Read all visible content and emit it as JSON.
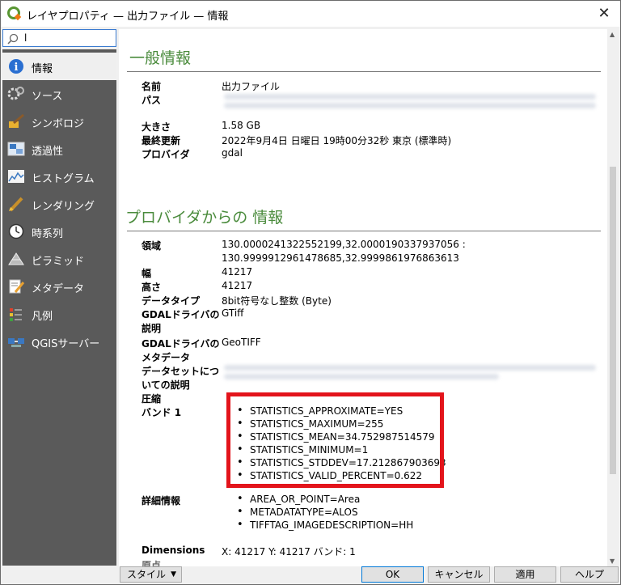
{
  "window": {
    "title": "レイヤプロパティ — 出力ファイル — 情報"
  },
  "search": {
    "value": "l"
  },
  "sidebar": {
    "items": [
      {
        "label": "情報",
        "icon": "info-icon"
      },
      {
        "label": "ソース",
        "icon": "source-icon"
      },
      {
        "label": "シンボロジ",
        "icon": "symbology-icon"
      },
      {
        "label": "透過性",
        "icon": "transparency-icon"
      },
      {
        "label": "ヒストグラム",
        "icon": "histogram-icon"
      },
      {
        "label": "レンダリング",
        "icon": "rendering-icon"
      },
      {
        "label": "時系列",
        "icon": "clock-icon"
      },
      {
        "label": "ピラミッド",
        "icon": "pyramid-icon"
      },
      {
        "label": "メタデータ",
        "icon": "metadata-icon"
      },
      {
        "label": "凡例",
        "icon": "legend-icon"
      },
      {
        "label": "QGISサーバー",
        "icon": "server-icon"
      }
    ]
  },
  "general": {
    "heading": "一般情報",
    "name_label": "名前",
    "name_value": "出力ファイル",
    "path_label": "パス",
    "size_label": "大きさ",
    "size_value": "1.58 GB",
    "modified_label": "最終更新",
    "modified_value": "2022年9月4日 日曜日 19時00分32秒 東京 (標準時)",
    "provider_label": "プロバイダ",
    "provider_value": "gdal"
  },
  "provider_info": {
    "heading": "プロバイダからの 情報",
    "extent_label": "領域",
    "extent_line1": "130.0000241322552199,32.0000190337937056 :",
    "extent_line2": "130.9999912961478685,32.9999861976863613",
    "width_label": "幅",
    "width_value": "41217",
    "height_label": "高さ",
    "height_value": "41217",
    "datatype_label": "データタイプ",
    "datatype_value": "8bit符号なし整数 (Byte)",
    "gdal_desc_label_1": "GDALドライバの",
    "gdal_desc_label_2": "説明",
    "gdal_desc_value": "GTiff",
    "gdal_meta_label_1": "GDALドライバの",
    "gdal_meta_label_2": "メタデータ",
    "gdal_meta_value": "GeoTIFF",
    "dataset_label_1": "データセットにつ",
    "dataset_label_2": "いての説明",
    "compression_label": "圧縮",
    "band_label": "バンド 1",
    "band_stats": [
      "STATISTICS_APPROXIMATE=YES",
      "STATISTICS_MAXIMUM=255",
      "STATISTICS_MEAN=34.752987514579",
      "STATISTICS_MINIMUM=1",
      "STATISTICS_STDDEV=17.212867903693",
      "STATISTICS_VALID_PERCENT=0.622"
    ],
    "detail_label": "詳細情報",
    "detail_items": [
      "AREA_OR_POINT=Area",
      "METADATATYPE=ALOS",
      "TIFFTAG_IMAGEDESCRIPTION=HH"
    ],
    "dimensions_label": "Dimensions",
    "dimensions_value": "X: 41217 Y: 41217 バンド: 1",
    "cutoff_label": "原点"
  },
  "buttons": {
    "style": "スタイル",
    "ok": "OK",
    "cancel": "キャンセル",
    "apply": "適用",
    "help": "ヘルプ"
  },
  "colors": {
    "heading": "#4a8b3c",
    "sidebar": "#5a5a5a",
    "highlight_box": "#e3141b"
  }
}
